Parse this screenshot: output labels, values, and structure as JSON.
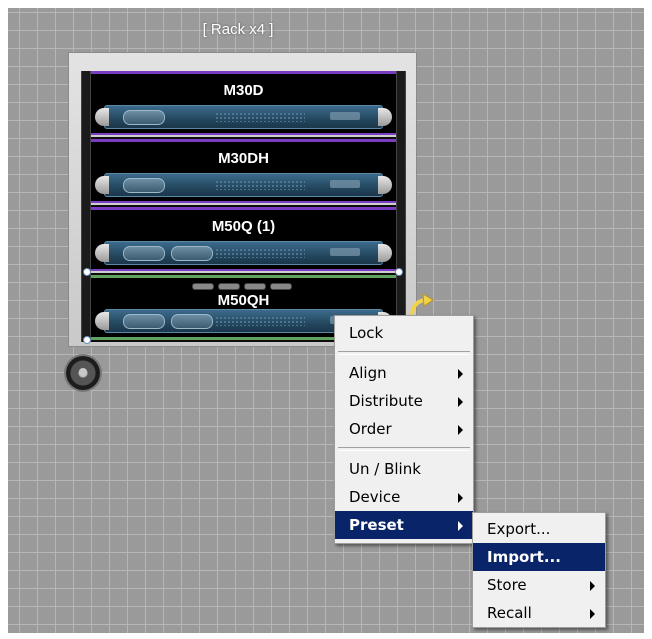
{
  "rack": {
    "title": "[ Rack x4 ]",
    "units": [
      {
        "label": "M30D"
      },
      {
        "label": "M30DH"
      },
      {
        "label": "M50Q (1)"
      },
      {
        "label": "M50QH"
      }
    ]
  },
  "context_menu": {
    "items": [
      {
        "label": "Lock"
      },
      {
        "label": "Align"
      },
      {
        "label": "Distribute"
      },
      {
        "label": "Order"
      },
      {
        "label": "Un / Blink"
      },
      {
        "label": "Device"
      },
      {
        "label": "Preset"
      }
    ]
  },
  "preset_submenu": {
    "items": [
      {
        "label": "Export..."
      },
      {
        "label": "Import..."
      },
      {
        "label": "Store"
      },
      {
        "label": "Recall"
      }
    ]
  },
  "icons": {
    "caster": "caster-wheel-icon",
    "rotate": "rotate-arrow-icon",
    "submenu": "submenu-arrow-icon"
  },
  "colors": {
    "selection_purple": "#7a3cc0",
    "selection_green": "#5fa35f",
    "menu_highlight": "#0a246a"
  }
}
